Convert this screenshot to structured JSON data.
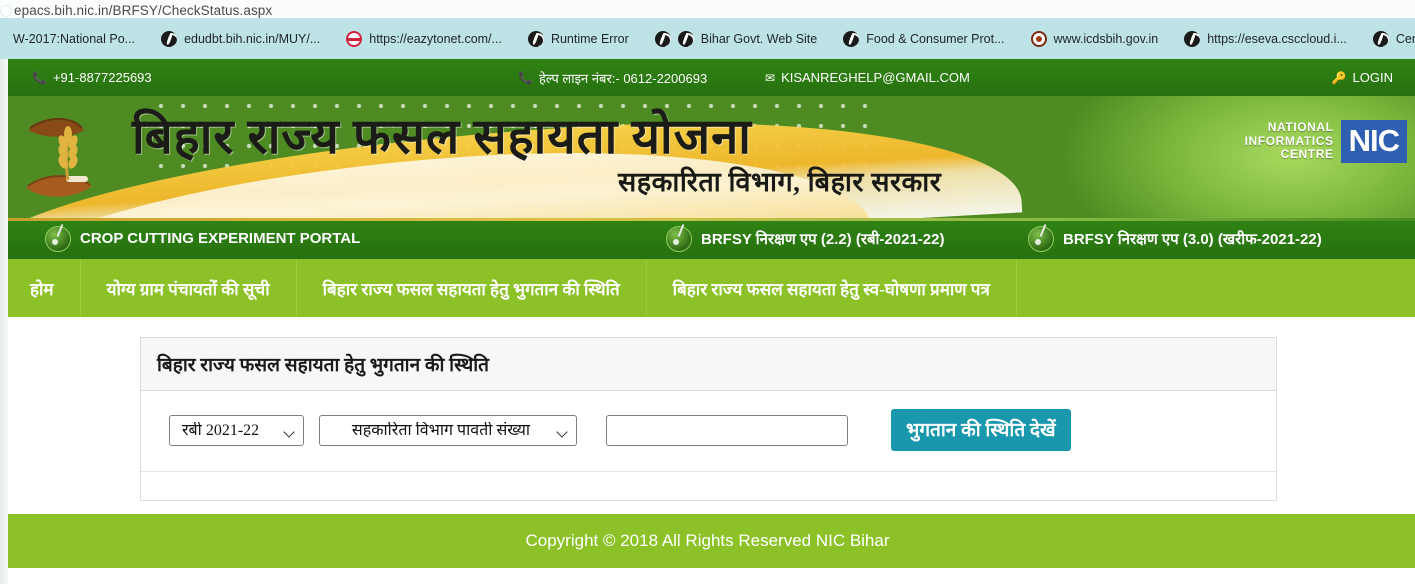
{
  "browser": {
    "url": "epacs.bih.nic.in/BRFSY/CheckStatus.aspx",
    "bookmarks": [
      {
        "label": "W-2017:National Po...",
        "icon": "none-icon"
      },
      {
        "label": "edudbt.bih.nic.in/MUY/...",
        "icon": "globe-icon"
      },
      {
        "label": "https://eazytonet.com/...",
        "icon": "red-circle-icon"
      },
      {
        "label": "Runtime Error",
        "icon": "globe-icon"
      },
      {
        "label": "Bihar Govt. Web Site",
        "icon": "globe-icon"
      },
      {
        "label": "Food & Consumer Prot...",
        "icon": "globe-icon"
      },
      {
        "label": "www.icdsbih.gov.in",
        "icon": "icds-emblem-icon"
      },
      {
        "label": "https://eseva.csccloud.i...",
        "icon": "globe-icon"
      },
      {
        "label": "Census of In",
        "icon": "globe-icon"
      }
    ]
  },
  "topbar": {
    "phone": "+91-8877225693",
    "helpline": "हेल्प लाइन नंबर:- 0612-2200693",
    "email": "KISANREGHELP@GMAIL.COM",
    "login": "LOGIN",
    "phone_icon": "phone-icon",
    "mail_icon": "envelope-icon",
    "login_icon": "key-icon"
  },
  "banner": {
    "title": "बिहार राज्य फसल सहायता योजना",
    "subtitle": "सहकारिता विभाग, बिहार सरकार",
    "nic_line1": "NATIONAL",
    "nic_line2": "INFORMATICS",
    "nic_line3": "CENTRE",
    "nic_badge": "NIC"
  },
  "portal_strip": {
    "links": [
      {
        "label": "CROP CUTTING EXPERIMENT PORTAL"
      },
      {
        "label": "BRFSY निरक्षण एप (2.2) (रबी-2021-22)"
      },
      {
        "label": "BRFSY निरक्षण एप (3.0) (खरीफ-2021-22)"
      }
    ]
  },
  "nav": {
    "items": [
      {
        "label": "होम"
      },
      {
        "label": "योग्य ग्राम पंचायतों की सूची"
      },
      {
        "label": "बिहार राज्य फसल सहायता हेतु भुगतान की स्थिति"
      },
      {
        "label": "बिहार राज्य फसल सहायता हेतु स्व-घोषणा प्रमाण पत्र"
      }
    ]
  },
  "panel": {
    "title": "बिहार राज्य फसल सहायता हेतु भुगतान की स्थिति",
    "season_select": {
      "value": "रबी 2021-22",
      "options": [
        "रबी 2021-22"
      ]
    },
    "type_select": {
      "value": "सहकारिता विभाग पावती संख्या",
      "options": [
        "सहकारिता विभाग पावती संख्या"
      ]
    },
    "number_input": {
      "value": "",
      "placeholder": ""
    },
    "submit_label": "भुगतान की स्थिति देखें"
  },
  "footer": {
    "copyright": "Copyright © 2018 All Rights Reserved NIC Bihar"
  },
  "colors": {
    "dark_green": "#27700f",
    "light_green": "#8cc228",
    "teal_button": "#1997ad",
    "bookmark_bar": "#bde3e6",
    "nic_blue": "#2f5fb0"
  }
}
